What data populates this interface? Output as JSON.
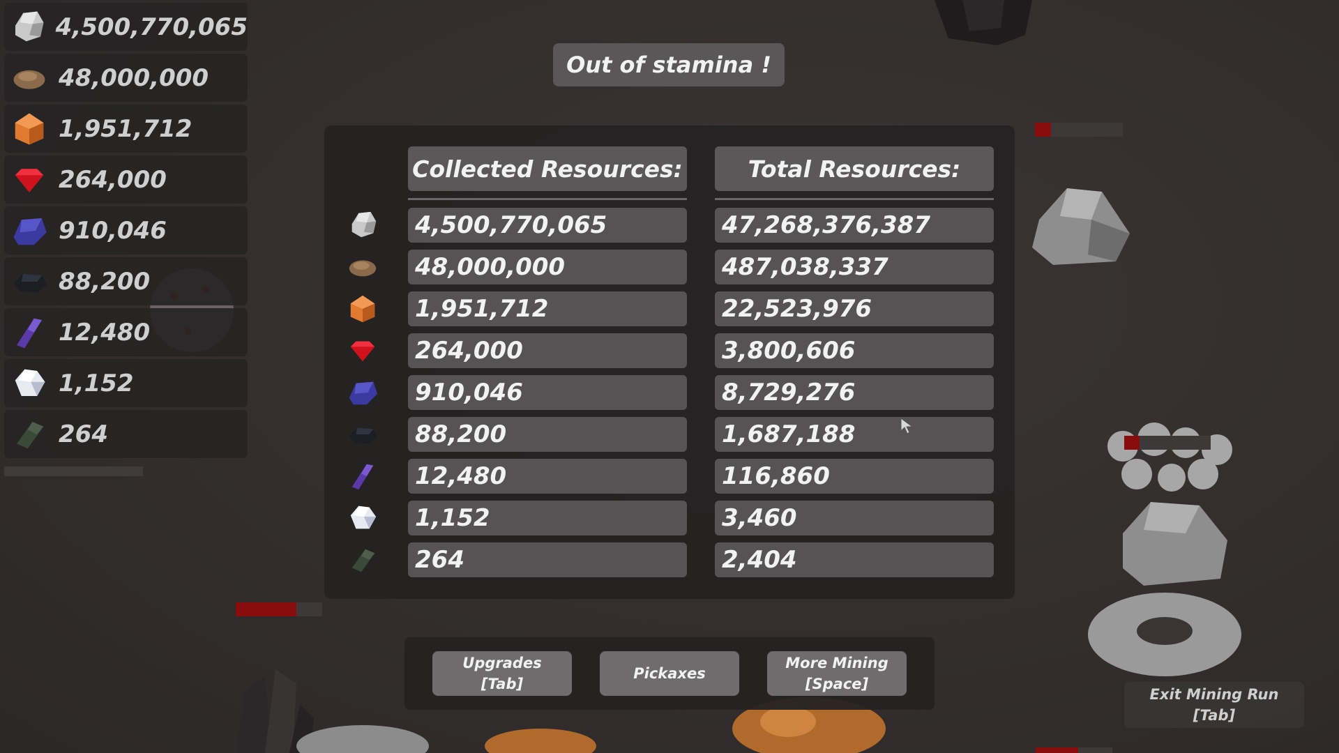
{
  "title": "Out of stamina !",
  "sidebar": {
    "items": [
      {
        "icon": "stone-ore-icon",
        "value": "4,500,770,065"
      },
      {
        "icon": "copper-ore-icon",
        "value": "48,000,000"
      },
      {
        "icon": "amber-gem-icon",
        "value": "1,951,712"
      },
      {
        "icon": "ruby-gem-icon",
        "value": "264,000"
      },
      {
        "icon": "sapphire-gem-icon",
        "value": "910,046"
      },
      {
        "icon": "obsidian-ore-icon",
        "value": "88,200"
      },
      {
        "icon": "amethyst-crystal-icon",
        "value": "12,480"
      },
      {
        "icon": "diamond-gem-icon",
        "value": "1,152"
      },
      {
        "icon": "emerald-shard-icon",
        "value": "264"
      }
    ]
  },
  "panel": {
    "collected_header": "Collected Resources:",
    "total_header": "Total Resources:",
    "rows": [
      {
        "icon": "stone-ore-icon",
        "collected": "4,500,770,065",
        "total": "47,268,376,387"
      },
      {
        "icon": "copper-ore-icon",
        "collected": "48,000,000",
        "total": "487,038,337"
      },
      {
        "icon": "amber-gem-icon",
        "collected": "1,951,712",
        "total": "22,523,976"
      },
      {
        "icon": "ruby-gem-icon",
        "collected": "264,000",
        "total": "3,800,606"
      },
      {
        "icon": "sapphire-gem-icon",
        "collected": "910,046",
        "total": "8,729,276"
      },
      {
        "icon": "obsidian-ore-icon",
        "collected": "88,200",
        "total": "1,687,188"
      },
      {
        "icon": "amethyst-crystal-icon",
        "collected": "12,480",
        "total": "116,860"
      },
      {
        "icon": "diamond-gem-icon",
        "collected": "1,152",
        "total": "3,460"
      },
      {
        "icon": "emerald-shard-icon",
        "collected": "264",
        "total": "2,404"
      }
    ]
  },
  "buttons": {
    "upgrades_line1": "Upgrades",
    "upgrades_line2": "[Tab]",
    "pickaxes": "Pickaxes",
    "more_mining_line1": "More Mining",
    "more_mining_line2": "[Space]"
  },
  "exit": {
    "line1": "Exit Mining Run",
    "line2": "[Tab]"
  },
  "colors": {
    "stone": "#c9c9c9",
    "copper": "#8a6a4a",
    "amber": "#e07a30",
    "ruby": "#d0121c",
    "sapphire": "#3a3aa0",
    "obsidian": "#1c1e24",
    "amethyst": "#5a3aa8",
    "diamond": "#e8eaf2",
    "emerald": "#3a4a38",
    "health_fill": "#8a0d0d"
  }
}
